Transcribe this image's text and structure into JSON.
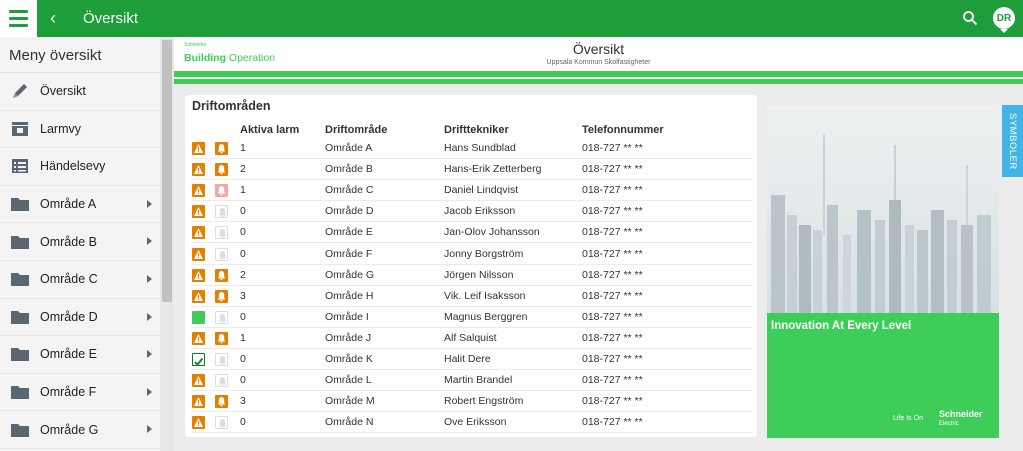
{
  "topbar": {
    "title": "Översikt",
    "avatar_initials": "DR",
    "back_icon": "chevron-left-icon",
    "menu_icon": "hamburger-icon",
    "search_icon": "search-icon"
  },
  "sidebar": {
    "title": "Meny översikt",
    "items": [
      {
        "label": "Översikt",
        "icon": "pen-icon"
      },
      {
        "label": "Larmvy",
        "icon": "alarm-view-icon"
      },
      {
        "label": "Händelsevy",
        "icon": "event-list-icon"
      },
      {
        "label": "Område A",
        "icon": "folder-icon"
      },
      {
        "label": "Område B",
        "icon": "folder-icon"
      },
      {
        "label": "Område C",
        "icon": "folder-icon"
      },
      {
        "label": "Område D",
        "icon": "folder-icon"
      },
      {
        "label": "Område E",
        "icon": "folder-icon"
      },
      {
        "label": "Område F",
        "icon": "folder-icon"
      },
      {
        "label": "Område G",
        "icon": "folder-icon"
      }
    ]
  },
  "header": {
    "brand_small": "Schneider",
    "brand_bold": "Building",
    "brand_rest": " Operation",
    "title": "Översikt",
    "subtitle": "Uppsala Kommun Skolfastigheter"
  },
  "table": {
    "title": "Driftområden",
    "headers": [
      "Aktiva larm",
      "Driftområde",
      "Drifttekniker",
      "Telefonnummer"
    ],
    "rows": [
      {
        "status": "alarm",
        "bell": "orange",
        "count": "1",
        "area": "Område A",
        "tech": "Hans Sundblad",
        "phone": "018-727 ** **"
      },
      {
        "status": "alarm",
        "bell": "orange",
        "count": "2",
        "area": "Område B",
        "tech": "Hans-Erik Zetterberg",
        "phone": "018-727 ** **"
      },
      {
        "status": "alarm",
        "bell": "pink",
        "count": "1",
        "area": "Område C",
        "tech": "Daniel Lindqvist",
        "phone": "018-727 ** **"
      },
      {
        "status": "alarm",
        "bell": "white",
        "count": "0",
        "area": "Område D",
        "tech": "Jacob Eriksson",
        "phone": "018-727 ** **"
      },
      {
        "status": "alarm",
        "bell": "white",
        "count": "0",
        "area": "Område E",
        "tech": "Jan-Olov Johansson",
        "phone": "018-727 ** **"
      },
      {
        "status": "alarm",
        "bell": "white",
        "count": "0",
        "area": "Område F",
        "tech": "Jonny Borgström",
        "phone": "018-727 ** **"
      },
      {
        "status": "alarm",
        "bell": "orange",
        "count": "2",
        "area": "Område G",
        "tech": "Jörgen Nilsson",
        "phone": "018-727 ** **"
      },
      {
        "status": "alarm",
        "bell": "orange",
        "count": "3",
        "area": "Område H",
        "tech": "Vik. Leif Isaksson",
        "phone": "018-727 ** **"
      },
      {
        "status": "ok-green",
        "bell": "white",
        "count": "0",
        "area": "Område I",
        "tech": "Magnus Berggren",
        "phone": "018-727 ** **"
      },
      {
        "status": "alarm",
        "bell": "orange",
        "count": "1",
        "area": "Område J",
        "tech": "Alf Salquist",
        "phone": "018-727 ** **"
      },
      {
        "status": "ok-check",
        "bell": "white",
        "count": "0",
        "area": "Område K",
        "tech": "Halit Dere",
        "phone": "018-727 ** **"
      },
      {
        "status": "alarm",
        "bell": "white",
        "count": "0",
        "area": "Område L",
        "tech": "Martin Brandel",
        "phone": "018-727 ** **"
      },
      {
        "status": "alarm",
        "bell": "orange",
        "count": "3",
        "area": "Område M",
        "tech": "Robert Engström",
        "phone": "018-727 ** **"
      },
      {
        "status": "alarm",
        "bell": "white",
        "count": "0",
        "area": "Område N",
        "tech": "Ove Eriksson",
        "phone": "018-727 ** **"
      }
    ]
  },
  "promo": {
    "headline": "Innovation At Every Level",
    "tagline": "Life Is On",
    "logo_main": "Schneider",
    "logo_sub": "Electric"
  },
  "side_tab": {
    "label": "SYMBOLER"
  },
  "colors": {
    "brand_green": "#1e9e3a",
    "accent_green": "#3dcd58",
    "alarm_orange": "#e47f00",
    "tab_blue": "#42b4e6"
  }
}
